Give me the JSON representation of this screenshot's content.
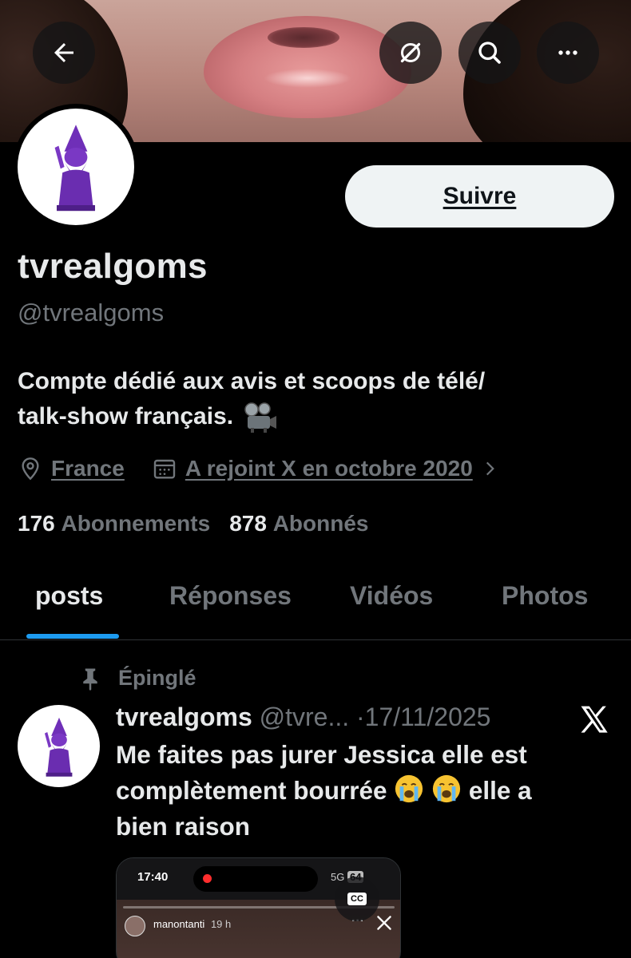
{
  "header": {
    "back_icon": "arrow-left-icon",
    "actions": [
      "translate-off-icon",
      "search-icon",
      "more-icon"
    ]
  },
  "profile": {
    "display_name": "tvrealgoms",
    "handle": "@tvrealgoms",
    "follow_label": "Suivre",
    "bio_line1": "Compte dédié aux avis et scoops de télé/",
    "bio_line2": "talk-show français.",
    "location": "France",
    "joined": "A rejoint X en octobre 2020",
    "following_count": "176",
    "following_label": "Abonnements",
    "followers_count": "878",
    "followers_label": "Abonnés"
  },
  "tabs": [
    {
      "label": "posts",
      "active": true
    },
    {
      "label": "Réponses",
      "active": false
    },
    {
      "label": "Vidéos",
      "active": false
    },
    {
      "label": "Photos",
      "active": false
    }
  ],
  "pinned_post": {
    "pinned_label": "Épinglé",
    "author_name": "tvrealgoms",
    "author_handle": "@tvre...",
    "separator": "·",
    "date": "17/11/2025",
    "text_line1": "Me faites pas jurer Jessica elle est",
    "text_line2_a": "complètement bourrée",
    "text_line2_b": "elle a",
    "text_line3": "bien raison",
    "media": {
      "status_time": "17:40",
      "network": "5G",
      "battery": "64",
      "story_user": "manontanti",
      "story_time": "19 h",
      "cc_label": "CC"
    }
  },
  "colors": {
    "background": "#000000",
    "text_primary": "#e7e9ea",
    "text_secondary": "#71767b",
    "accent": "#1d9bf0",
    "follow_bg": "#eff3f4"
  }
}
